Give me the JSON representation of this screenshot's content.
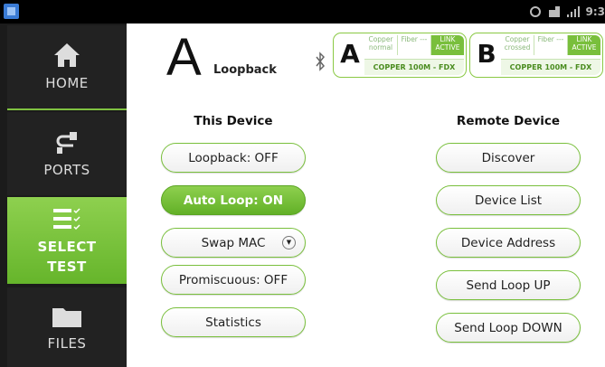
{
  "statusbar": {
    "time": "9:3"
  },
  "sidebar": {
    "items": [
      {
        "label": "HOME"
      },
      {
        "label": "PORTS"
      },
      {
        "label_line1": "SELECT",
        "label_line2": "TEST"
      },
      {
        "label": "FILES"
      }
    ]
  },
  "header": {
    "big_letter": "A",
    "mode_label": "Loopback"
  },
  "ports": {
    "a": {
      "letter": "A",
      "cells": [
        "Copper normal",
        "Fiber ---",
        "LINK ACTIVE"
      ],
      "speed": "COPPER 100M - FDX"
    },
    "b": {
      "letter": "B",
      "cells": [
        "Copper crossed",
        "Fiber ---",
        "LINK ACTIVE"
      ],
      "speed": "COPPER 100M - FDX"
    }
  },
  "this_device": {
    "heading": "This Device",
    "buttons": [
      "Loopback: OFF",
      "Auto Loop: ON",
      "Swap MAC",
      "Promiscuous: OFF",
      "Statistics"
    ]
  },
  "remote_device": {
    "heading": "Remote Device",
    "buttons": [
      "Discover",
      "Device List",
      "Device Address",
      "Send Loop UP",
      "Send Loop DOWN"
    ]
  },
  "colors": {
    "accent": "#79bf3c",
    "accent_dark": "#62b027",
    "sidebar": "#1b1b1b"
  }
}
